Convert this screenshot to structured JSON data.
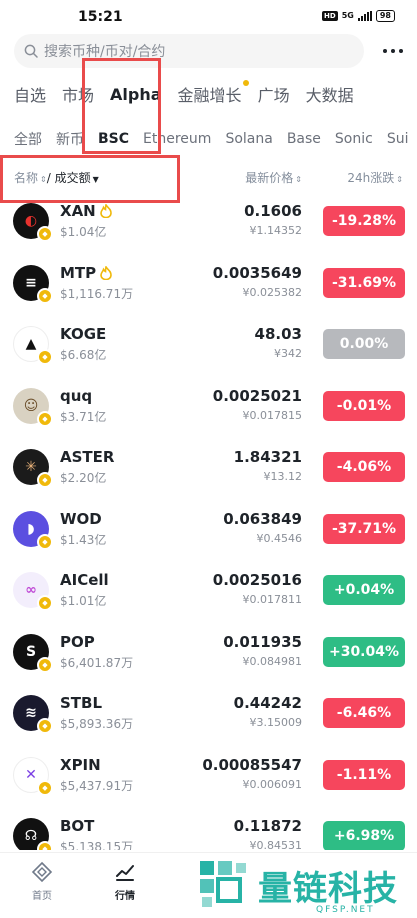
{
  "status_bar": {
    "time": "15:21",
    "hd": "HD",
    "network": "5G",
    "battery": "98"
  },
  "search": {
    "placeholder": "搜索币种/币对/合约"
  },
  "main_tabs": [
    {
      "label": "自选",
      "active": false
    },
    {
      "label": "市场",
      "active": false
    },
    {
      "label": "Alpha",
      "active": true
    },
    {
      "label": "金融增长",
      "active": false,
      "dot": true
    },
    {
      "label": "广场",
      "active": false
    },
    {
      "label": "大数据",
      "active": false
    }
  ],
  "chain_tabs": [
    {
      "label": "全部",
      "active": false
    },
    {
      "label": "新币",
      "active": false
    },
    {
      "label": "BSC",
      "active": true
    },
    {
      "label": "Ethereum",
      "active": false
    },
    {
      "label": "Solana",
      "active": false
    },
    {
      "label": "Base",
      "active": false
    },
    {
      "label": "Sonic",
      "active": false
    },
    {
      "label": "Sui",
      "active": false
    }
  ],
  "columns": {
    "name": "名称",
    "volume": "/ 成交额",
    "price": "最新价格",
    "change": "24h涨跌"
  },
  "colors": {
    "negative": "#f6465d",
    "positive": "#2ebd85",
    "flat": "#b7b9bd",
    "brand": "#f0b90b",
    "highlight_box": "#e94b4b",
    "watermark": "#27b3a6"
  },
  "coins": [
    {
      "symbol": "XAN",
      "volume": "$1.04亿",
      "price": "0.1606",
      "fiat": "¥1.14352",
      "change": "-19.28%",
      "dir": "neg",
      "hot": true,
      "icon": "xan-logo-icon",
      "icon_bg": "#111111",
      "icon_fg": "#e8322e",
      "glyph": "◐"
    },
    {
      "symbol": "MTP",
      "volume": "$1,116.71万",
      "price": "0.0035649",
      "fiat": "¥0.025382",
      "change": "-31.69%",
      "dir": "neg",
      "hot": true,
      "icon": "mtp-logo-icon",
      "icon_bg": "#111111",
      "icon_fg": "#ffffff",
      "glyph": "≡"
    },
    {
      "symbol": "KOGE",
      "volume": "$6.68亿",
      "price": "48.03",
      "fiat": "¥342",
      "change": "0.00%",
      "dir": "flat",
      "hot": false,
      "icon": "koge-logo-icon",
      "icon_bg": "#ffffff",
      "icon_fg": "#111111",
      "glyph": "▲"
    },
    {
      "symbol": "quq",
      "volume": "$3.71亿",
      "price": "0.0025021",
      "fiat": "¥0.017815",
      "change": "-0.01%",
      "dir": "neg",
      "hot": false,
      "icon": "quq-avatar-icon",
      "icon_bg": "#d9d2c2",
      "icon_fg": "#6b4e2a",
      "glyph": "☺"
    },
    {
      "symbol": "ASTER",
      "volume": "$2.20亿",
      "price": "1.84321",
      "fiat": "¥13.12",
      "change": "-4.06%",
      "dir": "neg",
      "hot": false,
      "icon": "aster-logo-icon",
      "icon_bg": "#1b1b1b",
      "icon_fg": "#e8b27a",
      "glyph": "✳"
    },
    {
      "symbol": "WOD",
      "volume": "$1.43亿",
      "price": "0.063849",
      "fiat": "¥0.4546",
      "change": "-37.71%",
      "dir": "neg",
      "hot": false,
      "icon": "wod-logo-icon",
      "icon_bg": "#5b4fe0",
      "icon_fg": "#ffffff",
      "glyph": "◗"
    },
    {
      "symbol": "AICell",
      "volume": "$1.01亿",
      "price": "0.0025016",
      "fiat": "¥0.017811",
      "change": "+0.04%",
      "dir": "pos",
      "hot": false,
      "icon": "aicell-logo-icon",
      "icon_bg": "#f3eefc",
      "icon_fg": "#c04bd6",
      "glyph": "∞"
    },
    {
      "symbol": "POP",
      "volume": "$6,401.87万",
      "price": "0.011935",
      "fiat": "¥0.084981",
      "change": "+30.04%",
      "dir": "pos",
      "hot": false,
      "icon": "pop-logo-icon",
      "icon_bg": "#111111",
      "icon_fg": "#ffffff",
      "glyph": "S"
    },
    {
      "symbol": "STBL",
      "volume": "$5,893.36万",
      "price": "0.44242",
      "fiat": "¥3.15009",
      "change": "-6.46%",
      "dir": "neg",
      "hot": false,
      "icon": "stbl-logo-icon",
      "icon_bg": "#1a1a2e",
      "icon_fg": "#ffffff",
      "glyph": "≋"
    },
    {
      "symbol": "XPIN",
      "volume": "$5,437.91万",
      "price": "0.00085547",
      "fiat": "¥0.006091",
      "change": "-1.11%",
      "dir": "neg",
      "hot": false,
      "icon": "xpin-logo-icon",
      "icon_bg": "#ffffff",
      "icon_fg": "#7b3fe4",
      "glyph": "✕"
    },
    {
      "symbol": "BOT",
      "volume": "$5,138.15万",
      "price": "0.11872",
      "fiat": "¥0.84531",
      "change": "+6.98%",
      "dir": "pos",
      "hot": false,
      "icon": "bot-logo-icon",
      "icon_bg": "#111111",
      "icon_fg": "#ffffff",
      "glyph": "☊"
    }
  ],
  "bottom_nav": [
    {
      "label": "首页",
      "icon": "home-icon",
      "active": false
    },
    {
      "label": "行情",
      "icon": "market-chart-icon",
      "active": true
    }
  ],
  "watermark": {
    "text": "量链科技",
    "sub": "QFSP.NET"
  }
}
